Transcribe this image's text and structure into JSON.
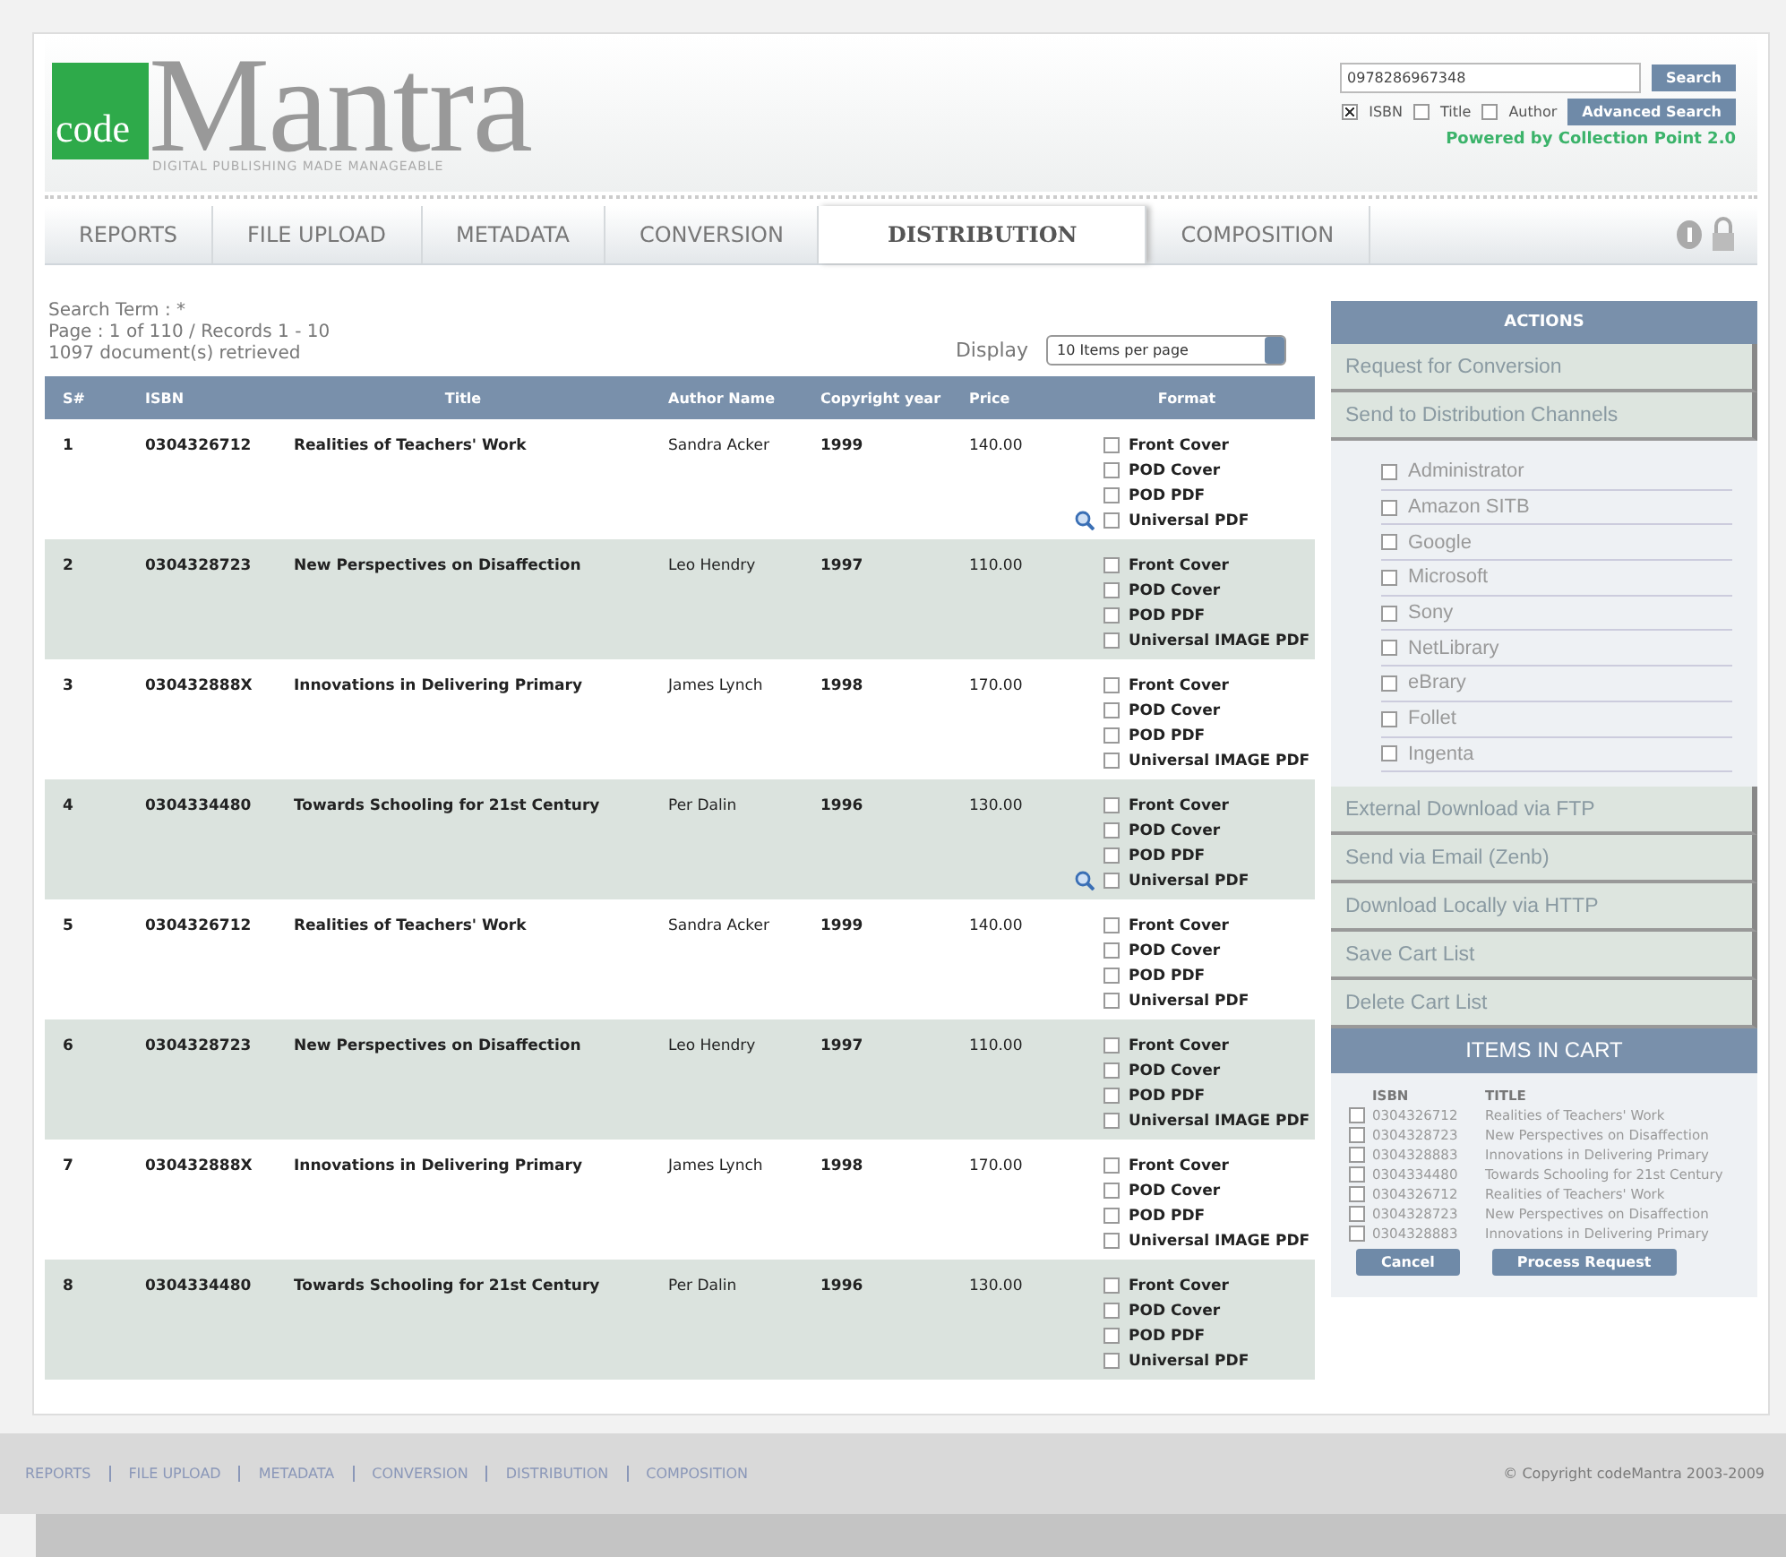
{
  "logo": {
    "mark": "code",
    "name": "Mantra",
    "tagline": "DIGITAL PUBLISHING MADE MANAGEABLE"
  },
  "search": {
    "value": "0978286967348",
    "button": "Search",
    "advanced": "Advanced Search",
    "powered": "Powered by Collection Point 2.0",
    "filters": [
      {
        "label": "ISBN",
        "checked": true
      },
      {
        "label": "Title",
        "checked": false
      },
      {
        "label": "Author",
        "checked": false
      }
    ]
  },
  "tabs": [
    {
      "label": "REPORTS",
      "selected": false
    },
    {
      "label": "FILE UPLOAD",
      "selected": false
    },
    {
      "label": "METADATA",
      "selected": false
    },
    {
      "label": "CONVERSION",
      "selected": false
    },
    {
      "label": "DISTRIBUTION",
      "selected": true
    },
    {
      "label": "COMPOSITION",
      "selected": false
    }
  ],
  "info": [
    "Search Term :  *",
    "Page : 1 of 110 / Records 1 - 10",
    "1097 document(s) retrieved"
  ],
  "display": {
    "label": "Display",
    "value": "10 Items per page"
  },
  "table": {
    "columns": [
      "S#",
      "ISBN",
      "Title",
      "Author Name",
      "Copyright year",
      "Price",
      "Format"
    ],
    "rows": [
      {
        "sn": "1",
        "isbn": "0304326712",
        "title": "Realities of Teachers' Work",
        "author": "Sandra Acker",
        "year": "1999",
        "price": "140.00",
        "preview": true,
        "formats": [
          {
            "label": "Front Cover",
            "checked": false
          },
          {
            "label": "POD Cover",
            "checked": false
          },
          {
            "label": "POD PDF",
            "checked": false
          },
          {
            "label": "Universal PDF",
            "checked": false
          }
        ]
      },
      {
        "sn": "2",
        "isbn": "0304328723",
        "title": "New Perspectives on Disaffection",
        "author": "Leo Hendry",
        "year": "1997",
        "price": "110.00",
        "preview": false,
        "formats": [
          {
            "label": "Front Cover",
            "checked": false
          },
          {
            "label": "POD Cover",
            "checked": false
          },
          {
            "label": "POD PDF",
            "checked": false
          },
          {
            "label": "Universal IMAGE PDF",
            "checked": false
          }
        ]
      },
      {
        "sn": "3",
        "isbn": "030432888X",
        "title": "Innovations in Delivering Primary",
        "author": "James Lynch",
        "year": "1998",
        "price": "170.00",
        "preview": false,
        "formats": [
          {
            "label": "Front Cover",
            "checked": false
          },
          {
            "label": "POD Cover",
            "checked": false
          },
          {
            "label": "POD PDF",
            "checked": false
          },
          {
            "label": "Universal IMAGE PDF",
            "checked": false
          }
        ]
      },
      {
        "sn": "4",
        "isbn": "0304334480",
        "title": "Towards Schooling for 21st Century",
        "author": "Per Dalin",
        "year": "1996",
        "price": "130.00",
        "preview": true,
        "formats": [
          {
            "label": "Front Cover",
            "checked": false
          },
          {
            "label": "POD Cover",
            "checked": false
          },
          {
            "label": "POD PDF",
            "checked": false
          },
          {
            "label": "Universal PDF",
            "checked": false
          }
        ]
      },
      {
        "sn": "5",
        "isbn": "0304326712",
        "title": "Realities of Teachers' Work",
        "author": "Sandra Acker",
        "year": "1999",
        "price": "140.00",
        "preview": false,
        "formats": [
          {
            "label": "Front Cover",
            "checked": false
          },
          {
            "label": "POD Cover",
            "checked": false
          },
          {
            "label": "POD PDF",
            "checked": false
          },
          {
            "label": "Universal PDF",
            "checked": false
          }
        ]
      },
      {
        "sn": "6",
        "isbn": "0304328723",
        "title": "New Perspectives on Disaffection",
        "author": "Leo Hendry",
        "year": "1997",
        "price": "110.00",
        "preview": false,
        "formats": [
          {
            "label": "Front Cover",
            "checked": false
          },
          {
            "label": "POD Cover",
            "checked": false
          },
          {
            "label": "POD PDF",
            "checked": false
          },
          {
            "label": "Universal IMAGE PDF",
            "checked": false
          }
        ]
      },
      {
        "sn": "7",
        "isbn": "030432888X",
        "title": "Innovations in Delivering Primary",
        "author": "James Lynch",
        "year": "1998",
        "price": "170.00",
        "preview": false,
        "formats": [
          {
            "label": "Front Cover",
            "checked": false
          },
          {
            "label": "POD Cover",
            "checked": false
          },
          {
            "label": "POD PDF",
            "checked": false
          },
          {
            "label": "Universal IMAGE PDF",
            "checked": false
          }
        ]
      },
      {
        "sn": "8",
        "isbn": "0304334480",
        "title": "Towards Schooling for 21st Century",
        "author": "Per Dalin",
        "year": "1996",
        "price": "130.00",
        "preview": false,
        "formats": [
          {
            "label": "Front Cover",
            "checked": false
          },
          {
            "label": "POD Cover",
            "checked": false
          },
          {
            "label": "POD PDF",
            "checked": false
          },
          {
            "label": "Universal PDF",
            "checked": false
          }
        ]
      }
    ]
  },
  "actions": {
    "title": "ACTIONS",
    "items": [
      {
        "label": "Request for Conversion"
      },
      {
        "label": "Send to Distribution Channels",
        "channels": [
          {
            "label": "Administrator",
            "checked": false
          },
          {
            "label": "Amazon SITB",
            "checked": false
          },
          {
            "label": "Google",
            "checked": false
          },
          {
            "label": "Microsoft",
            "checked": false
          },
          {
            "label": "Sony",
            "checked": false
          },
          {
            "label": "NetLibrary",
            "checked": false
          },
          {
            "label": "eBrary",
            "checked": false
          },
          {
            "label": "Follet",
            "checked": false
          },
          {
            "label": "Ingenta",
            "checked": false
          }
        ]
      },
      {
        "label": "External Download via FTP"
      },
      {
        "label": "Send via Email (Zenb)"
      },
      {
        "label": "Download Locally via HTTP"
      },
      {
        "label": "Save Cart List"
      },
      {
        "label": "Delete Cart List"
      }
    ]
  },
  "cart": {
    "title": "ITEMS IN CART",
    "columns": [
      "ISBN",
      "TITLE"
    ],
    "items": [
      {
        "isbn": "0304326712",
        "title": "Realities of Teachers' Work",
        "checked": false
      },
      {
        "isbn": "0304328723",
        "title": "New Perspectives on Disaffection",
        "checked": false
      },
      {
        "isbn": "0304328883",
        "title": "Innovations in Delivering Primary",
        "checked": false
      },
      {
        "isbn": "0304334480",
        "title": "Towards Schooling for 21st Century",
        "checked": false
      },
      {
        "isbn": "0304326712",
        "title": "Realities of Teachers' Work",
        "checked": false
      },
      {
        "isbn": "0304328723",
        "title": "New Perspectives on Disaffection",
        "checked": false
      },
      {
        "isbn": "0304328883",
        "title": "Innovations in Delivering Primary",
        "checked": false
      }
    ],
    "buttons": [
      "Cancel",
      "Process Request"
    ]
  },
  "footer": {
    "links": [
      "REPORTS",
      "FILE UPLOAD",
      "METADATA",
      "CONVERSION",
      "DISTRIBUTION",
      "COMPOSITION"
    ],
    "copyright": "© Copyright codeMantra 2003-2009"
  }
}
